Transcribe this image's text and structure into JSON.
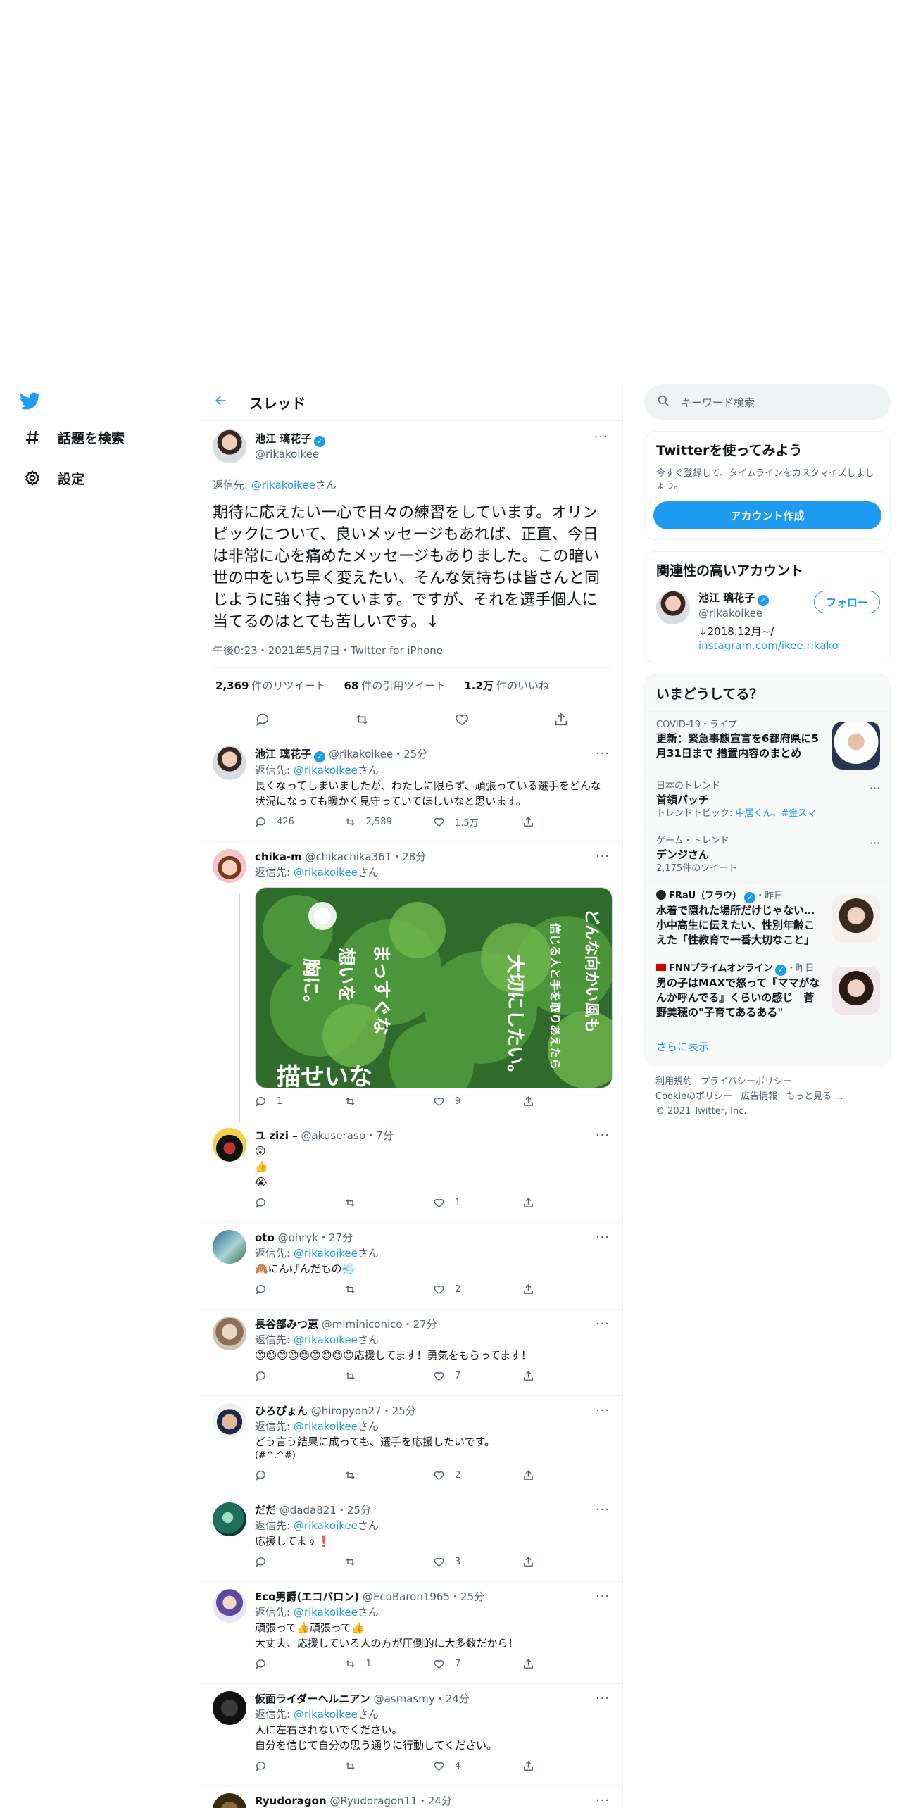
{
  "colors": {
    "accent": "#1d9bf0",
    "text": "#0f1419",
    "muted": "#536471",
    "like": "#f91880"
  },
  "nav": {
    "logo": "twitter-bird-icon",
    "items": [
      {
        "icon": "hashtag-icon",
        "label": "話題を検索"
      },
      {
        "icon": "gear-icon",
        "label": "設定"
      }
    ]
  },
  "header": {
    "title": "スレッド"
  },
  "focal": {
    "name": "池江 璃花子",
    "handle": "@rikakoikee",
    "reply_prefix": "返信先: ",
    "reply_to": "@rikakoikee",
    "reply_suffix": "さん",
    "text": "期待に応えたい一心で日々の練習をしています。オリンピックについて、良いメッセージもあれば、正直、今日は非常に心を痛めたメッセージもありました。この暗い世の中をいち早く変えたい、そんな気持ちは皆さんと同じように強く持っています。ですが、それを選手個人に当てるのはとても苦しいです。↓",
    "meta": "午後0:23・2021年5月7日・Twitter for iPhone",
    "stats": [
      {
        "num": "2,369",
        "label": "件のリツイート"
      },
      {
        "num": "68",
        "label": "件の引用ツイート"
      },
      {
        "num": "1.2万",
        "label": "件のいいね"
      }
    ]
  },
  "replies": [
    {
      "name": "池江 璃花子",
      "verified": true,
      "handle": "@rikakoikee",
      "time": "・25分",
      "reply_to": "@rikakoikee",
      "suffix": "さん",
      "text": "長くなってしまいましたが、わたしに限らず、頑張っている選手をどんな状況になっても暖かく見守っていてほしいなと思います。",
      "replies": "426",
      "retweets": "2,589",
      "likes": "1.5万"
    },
    {
      "name": "chika-m",
      "handle": "@chikachika361",
      "time": "・28分",
      "reply_to": "@rikakoikee",
      "suffix": "さん",
      "text": "",
      "replies": "1",
      "retweets": "",
      "likes": "9",
      "image_text": [
        "どんな向かい風も",
        "信じる人と手を取りあえたら",
        "大切にしたい。",
        "まっすぐな",
        "想いを",
        "胸に。",
        "描せいな"
      ]
    },
    {
      "name": "ユ zizi –",
      "handle": "@akuserasp",
      "time": "・7分",
      "text_lines": [
        "😲",
        "👍",
        "😭"
      ],
      "replies": "",
      "retweets": "",
      "likes": "1"
    },
    {
      "name": "oto",
      "handle": "@ohryk",
      "time": "・27分",
      "reply_to": "@rikakoikee",
      "suffix": "さん",
      "text": "🙈にんげんだもの💨",
      "replies": "",
      "retweets": "",
      "likes": "2"
    },
    {
      "name": "長谷部みつ恵",
      "handle": "@miminiconico",
      "time": "・27分",
      "reply_to": "@rikakoikee",
      "suffix": "さん",
      "text": "😊😊😊😊😊😊😊😊😊応援してます！勇気をもらってます！",
      "replies": "",
      "retweets": "",
      "likes": "7"
    },
    {
      "name": "ひろぴょん",
      "handle": "@hiropyon27",
      "time": "・25分",
      "reply_to": "@rikakoikee",
      "suffix": "さん",
      "text_lines": [
        "どう言う結果に成っても、選手を応援したいです。",
        "(#^.^#)"
      ],
      "replies": "",
      "retweets": "",
      "likes": "2"
    },
    {
      "name": "だだ",
      "handle": "@dada821",
      "time": "・25分",
      "reply_to": "@rikakoikee",
      "suffix": "さん",
      "text": "応援してます❗",
      "replies": "",
      "retweets": "",
      "likes": "3"
    },
    {
      "name": "Eco男爵(エコバロン)",
      "handle": "@EcoBaron1965",
      "time": "・25分",
      "reply_to": "@rikakoikee",
      "suffix": "さん",
      "text_lines": [
        "頑張って👍頑張って👍",
        "大丈夫、応援している人の方が圧倒的に大多数だから！"
      ],
      "replies": "",
      "retweets": "1",
      "likes": "7"
    },
    {
      "name": "仮面ライダーヘルニアン",
      "handle": "@asmasmy",
      "time": "・24分",
      "reply_to": "@rikakoikee",
      "suffix": "さん",
      "text_lines": [
        "人に左右されないでください。",
        "自分を信じて自分の思う通りに行動してください。"
      ],
      "replies": "",
      "retweets": "",
      "likes": "4"
    },
    {
      "name": "Ryudoragon",
      "handle": "@Ryudoragon11",
      "time": "・24分"
    }
  ],
  "right": {
    "search_placeholder": "キーワード検索",
    "try": {
      "title": "Twitterを使ってみよう",
      "sub": "今すぐ登録して、タイムラインをカスタマイズしましょう。",
      "button": "アカウント作成"
    },
    "related": {
      "title": "関連性の高いアカウント",
      "name": "池江 璃花子",
      "handle": "@rikakoikee",
      "bio1": "↓2018.12月~/",
      "bio2": "instagram.com/ikee.rikako",
      "follow": "フォロー"
    },
    "trends": {
      "title": "いまどうしてる？",
      "items": [
        {
          "cat": "COVID-19・ライブ",
          "title": "更新：緊急事態宣言を6都府県に5月31日まで 措置内容のまとめ"
        },
        {
          "cat": "日本のトレンド",
          "title": "首領パッチ",
          "meta_prefix": "トレンドトピック: ",
          "meta_links": "中居くん、#金スマ"
        },
        {
          "cat": "ゲーム・トレンド",
          "title": "デンジさん",
          "meta": "2,175件のツイート"
        },
        {
          "source": "FRaU（フラウ）",
          "when": "・昨日",
          "title": "水着で隠れた場所だけじゃない…小中高生に伝えたい、性別年齢こえた「性教育で一番大切なこと」"
        },
        {
          "source": "FNNプライムオンライン",
          "when": "・昨日",
          "title": "男の子はMAXで怒って『ママがなんか呼んでる』くらいの感じ　菅野美穂の\"子育てあるある\""
        }
      ],
      "show_more": "さらに表示"
    },
    "footer": {
      "line1": [
        "利用規約",
        "プライバシーポリシー"
      ],
      "line2": [
        "Cookieのポリシー",
        "広告情報",
        "もっと見る ..."
      ],
      "line3": "© 2021 Twitter, Inc."
    }
  }
}
